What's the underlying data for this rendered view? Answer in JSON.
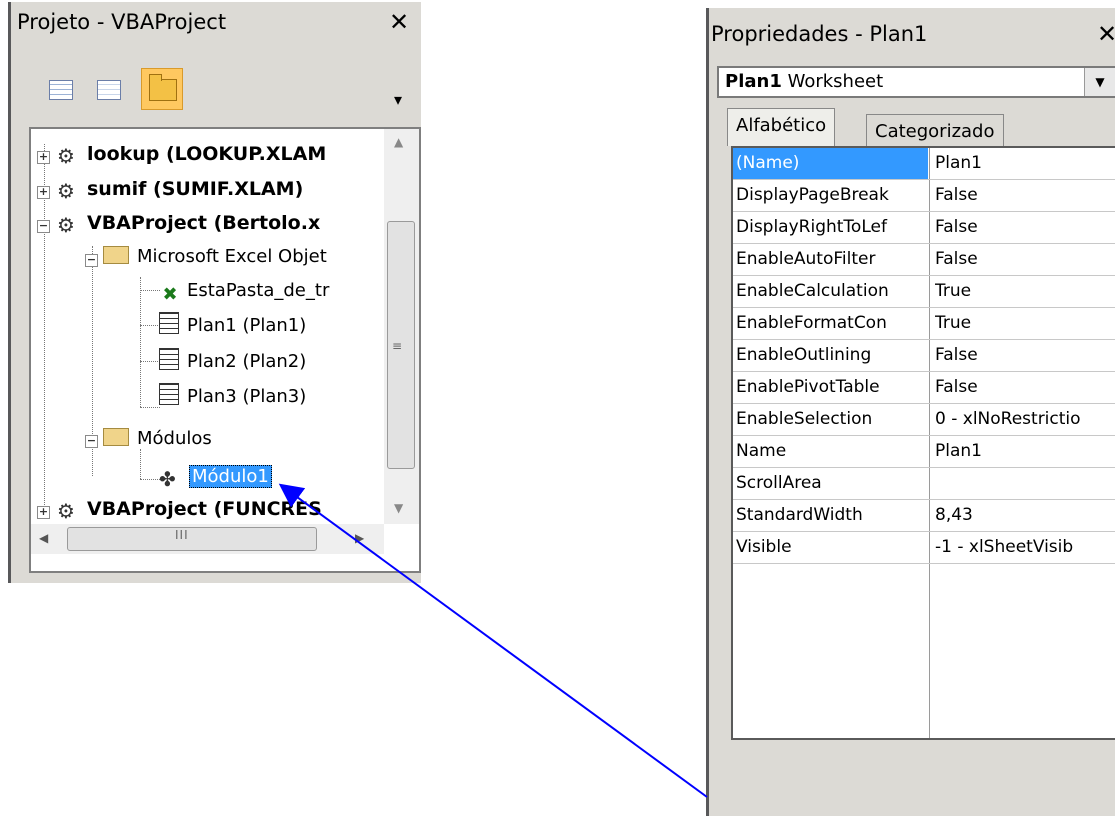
{
  "project": {
    "title": "Projeto - VBAProject",
    "close": "✕",
    "tree": [
      {
        "label": "lookup (LOOKUP.XLAM",
        "kind": "project",
        "state": "+"
      },
      {
        "label": "sumif (SUMIF.XLAM)",
        "kind": "project",
        "state": "+"
      },
      {
        "label": "VBAProject (Bertolo.x",
        "kind": "project",
        "state": "−"
      },
      {
        "label": "Microsoft Excel Objet",
        "kind": "folder",
        "state": "−"
      },
      {
        "label": "EstaPasta_de_tr",
        "kind": "workbook"
      },
      {
        "label": "Plan1 (Plan1)",
        "kind": "sheet"
      },
      {
        "label": "Plan2 (Plan2)",
        "kind": "sheet"
      },
      {
        "label": "Plan3 (Plan3)",
        "kind": "sheet"
      },
      {
        "label": "Módulos",
        "kind": "folder",
        "state": "−"
      },
      {
        "label": "Módulo1",
        "kind": "module",
        "selected": true
      },
      {
        "label": "VBAProject (FUNCRES",
        "kind": "project",
        "state": "+"
      }
    ]
  },
  "properties": {
    "title": "Propriedades - Plan1",
    "close": "✕",
    "object_name": "Plan1",
    "object_type": "Worksheet",
    "tabs": [
      "Alfabético",
      "Categorizado"
    ],
    "rows": [
      {
        "name": "(Name)",
        "value": "Plan1"
      },
      {
        "name": "DisplayPageBreak",
        "value": "False"
      },
      {
        "name": "DisplayRightToLef",
        "value": "False"
      },
      {
        "name": "EnableAutoFilter",
        "value": "False"
      },
      {
        "name": "EnableCalculation",
        "value": "True"
      },
      {
        "name": "EnableFormatCon",
        "value": "True"
      },
      {
        "name": "EnableOutlining",
        "value": "False"
      },
      {
        "name": "EnablePivotTable",
        "value": "False"
      },
      {
        "name": "EnableSelection",
        "value": "0 - xlNoRestrictio"
      },
      {
        "name": "Name",
        "value": "Plan1"
      },
      {
        "name": "ScrollArea",
        "value": ""
      },
      {
        "name": "StandardWidth",
        "value": "8,43"
      },
      {
        "name": "Visible",
        "value": "-1 - xlSheetVisib"
      }
    ]
  },
  "colors": {
    "selection": "#3399ff",
    "arrow": "#0000ff"
  }
}
